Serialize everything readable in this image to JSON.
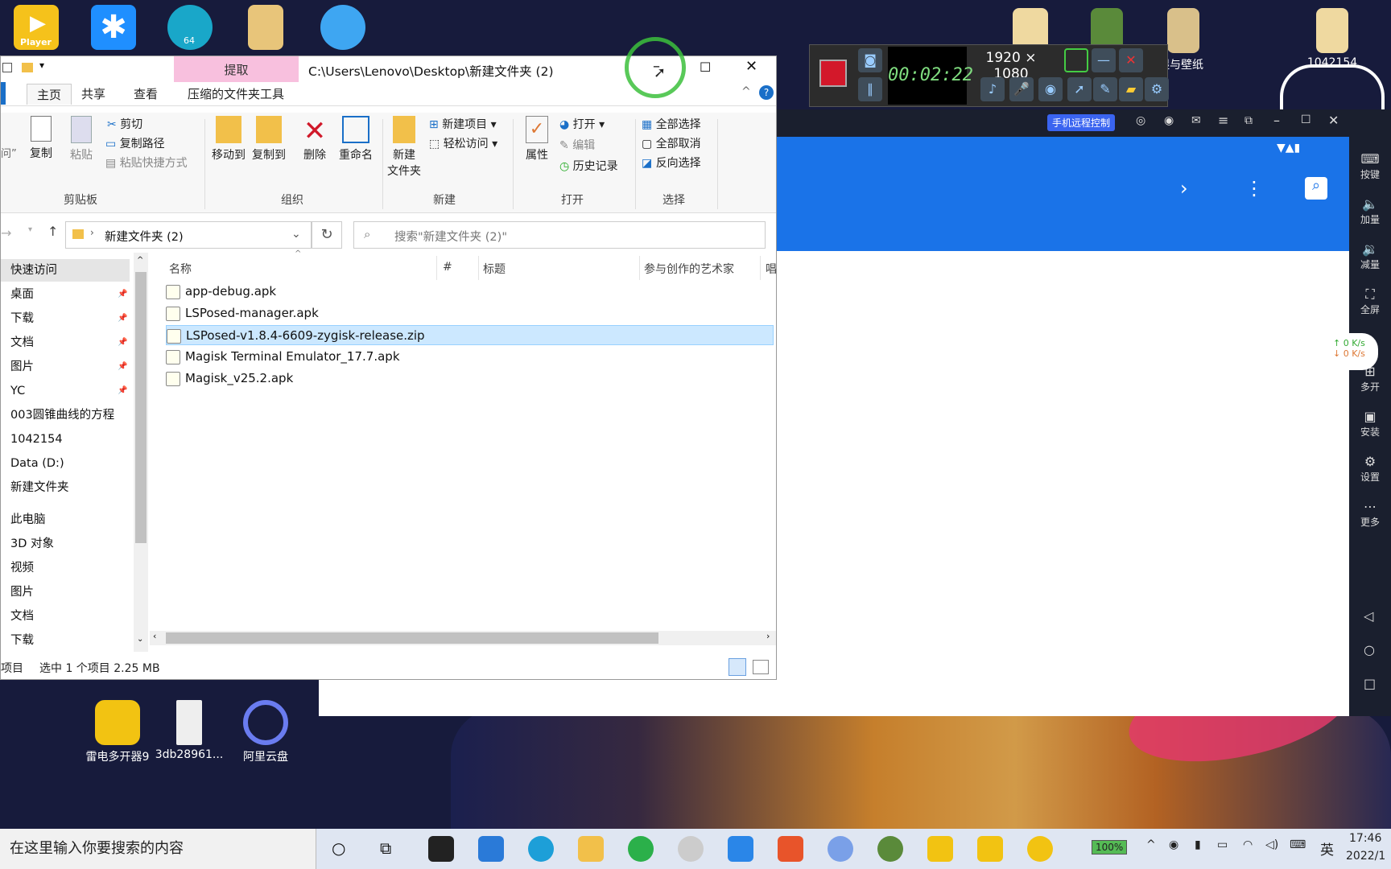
{
  "desktop": {
    "top_icons": [
      {
        "name": "player",
        "label": "Player"
      },
      {
        "name": "app2",
        "label": ""
      },
      {
        "name": "multi64",
        "label": "64"
      },
      {
        "name": "folder",
        "label": ""
      },
      {
        "name": "qq",
        "label": ""
      }
    ],
    "right_icons": [
      {
        "label": "湿与壁纸"
      },
      {
        "label": "1042154"
      }
    ],
    "bottom_icons": [
      {
        "label": "雷电多开器9"
      },
      {
        "label": "3db28961..."
      },
      {
        "label": "阿里云盘"
      }
    ]
  },
  "recorder": {
    "time": "00:02:22",
    "resolution": "1920 × 1080"
  },
  "emulator": {
    "remote_badge": "手机远程控制",
    "net_up": "0  K/s",
    "net_down": "0  K/s",
    "side": [
      "按键",
      "加量",
      "减量",
      "全屏",
      "多开",
      "安装",
      "设置",
      "更多"
    ]
  },
  "explorer": {
    "title": "C:\\Users\\Lenovo\\Desktop\\新建文件夹 (2)",
    "context_tab": "提取",
    "tabs": [
      "主页",
      "共享",
      "查看",
      "压缩的文件夹工具"
    ],
    "ribbon": {
      "cut_prefix": "问”",
      "copy": "复制",
      "paste": "粘贴",
      "cut": "剪切",
      "copy_path": "复制路径",
      "paste_shortcut": "粘贴快捷方式",
      "move_to": "移动到",
      "copy_to": "复制到",
      "delete": "删除",
      "rename": "重命名",
      "new_folder_l1": "新建",
      "new_folder_l2": "文件夹",
      "new_item": "新建项目",
      "easy_access": "轻松访问",
      "properties": "属性",
      "open": "打开",
      "edit": "编辑",
      "history": "历史记录",
      "select_all": "全部选择",
      "select_none": "全部取消",
      "invert": "反向选择",
      "groups": [
        "剪贴板",
        "组织",
        "新建",
        "打开",
        "选择"
      ]
    },
    "address": "新建文件夹 (2)",
    "search_placeholder": "搜索\"新建文件夹 (2)\"",
    "nav": [
      {
        "label": "快速访问",
        "pinned": false
      },
      {
        "label": "桌面",
        "pinned": true
      },
      {
        "label": "下载",
        "pinned": true
      },
      {
        "label": "文档",
        "pinned": true
      },
      {
        "label": "图片",
        "pinned": true
      },
      {
        "label": "YC",
        "pinned": true
      },
      {
        "label": "003圆锥曲线的方程",
        "pinned": false
      },
      {
        "label": "1042154",
        "pinned": false
      },
      {
        "label": "Data (D:)",
        "pinned": false
      },
      {
        "label": "新建文件夹",
        "pinned": false
      },
      {
        "label": "此电脑",
        "pinned": false
      },
      {
        "label": "3D 对象",
        "pinned": false
      },
      {
        "label": "视频",
        "pinned": false
      },
      {
        "label": "图片",
        "pinned": false
      },
      {
        "label": "文档",
        "pinned": false
      },
      {
        "label": "下载",
        "pinned": false
      }
    ],
    "columns": [
      "名称",
      "#",
      "标题",
      "参与创作的艺术家",
      "唱"
    ],
    "files": [
      {
        "name": "app-debug.apk",
        "selected": false
      },
      {
        "name": "LSPosed-manager.apk",
        "selected": false
      },
      {
        "name": "LSPosed-v1.8.4-6609-zygisk-release.zip",
        "selected": true
      },
      {
        "name": "Magisk Terminal Emulator_17.7.apk",
        "selected": false
      },
      {
        "name": "Magisk_v25.2.apk",
        "selected": false
      }
    ],
    "status_left": "项目",
    "status_selected": "选中 1 个项目  2.25 MB"
  },
  "taskbar": {
    "search_placeholder": "在这里输入你要搜索的内容",
    "battery": "100%",
    "ime": "英",
    "time": "17:46",
    "date": "2022/1"
  }
}
